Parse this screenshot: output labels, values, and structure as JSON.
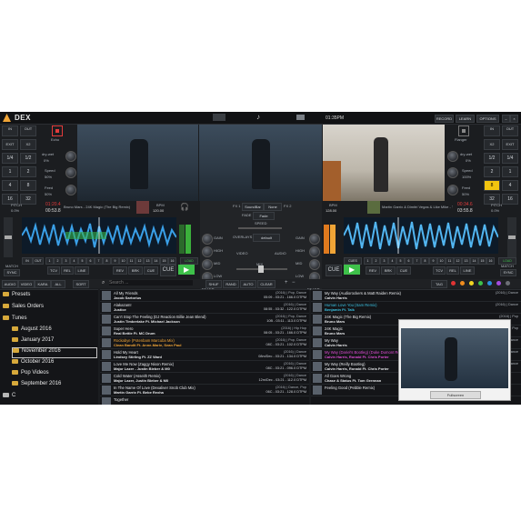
{
  "app": {
    "brand": "DEX",
    "clock": "01:35PM",
    "top_buttons": [
      "RECORD",
      "LEARN",
      "OPTIONS"
    ]
  },
  "left_deck": {
    "buttons": [
      "IN",
      "OUT",
      "EXIT",
      "X2",
      "1/4",
      "1/2",
      "1",
      "2",
      "4",
      "8",
      "16",
      "32"
    ],
    "fx_label": "Echo",
    "params": [
      {
        "name": "dry-wet",
        "value": "0%"
      },
      {
        "name": "Speed",
        "value": "50%"
      },
      {
        "name": "Feed",
        "value": "50%"
      }
    ],
    "pitch_label": "PITCH",
    "pitch_value": "0.0%",
    "time_top": "01:20.4",
    "time_bottom": "00:53.8",
    "title": "Bruno Mars - 24K Magic (The Big Remix)",
    "bpm_label": "BPM",
    "bpm_value": "120.00",
    "cue_buttons": [
      "IN",
      "OUT",
      "1",
      "2",
      "3",
      "4",
      "5",
      "6",
      "7",
      "8",
      "9",
      "10",
      "11",
      "12",
      "13",
      "14",
      "15",
      "16"
    ],
    "match": "MATCH",
    "sync": "SYNC",
    "modes": [
      "TCV",
      "REL",
      "LINE"
    ],
    "lower_buttons": [
      "REV",
      "BRK",
      "CUE"
    ],
    "cue": "CUE",
    "load": "LOAD"
  },
  "right_deck": {
    "buttons": [
      "IN",
      "OUT",
      "X2",
      "EXIT",
      "1/2",
      "1/4",
      "2",
      "1",
      "8",
      "4",
      "32",
      "16"
    ],
    "fx_label": "Flanger",
    "params": [
      {
        "name": "dry-wet",
        "value": "0%"
      },
      {
        "name": "Speed",
        "value": "100%"
      },
      {
        "name": "Feed",
        "value": "50%"
      }
    ],
    "pitch_label": "PITCH",
    "pitch_value": "0.0%",
    "time_top": "00:34.6",
    "time_bottom": "03:55.8",
    "title": "Martin Garrix & Dimitri Vegas & Like Mike - Tremor",
    "bpm_label": "BPM",
    "bpm_value": "128.00",
    "cue_buttons": [
      "CUES",
      "1",
      "2",
      "3",
      "4",
      "5",
      "6",
      "7",
      "8",
      "9",
      "10",
      "11",
      "12",
      "13",
      "14",
      "15",
      "16"
    ],
    "match": "MATCH",
    "sync": "SYNC",
    "modes": [
      "TCV",
      "REL",
      "LINE"
    ],
    "lower_buttons": [
      "REV",
      "BRK",
      "CUE"
    ],
    "cue": "CUE",
    "load": "LOAD"
  },
  "mixer": {
    "fx_left": "FX 1",
    "fx_right": "FX 2",
    "fx_select": "SoundBar",
    "fx_none": "None",
    "fade_label": "FADE",
    "fade_value": "Fade",
    "speed_label": "SPEED",
    "overlay_label": "OVERLAYS",
    "overlay_value": "default",
    "video_label": "VIDEO",
    "audio_label": "AUDIO",
    "mix_label": "MIX",
    "eq_left": [
      "GAIN",
      "HIGH",
      "MID",
      "LOW",
      "FILTER"
    ],
    "eq_right": [
      "GAIN",
      "HIGH",
      "MID",
      "LOW",
      "FILTER"
    ]
  },
  "browser_tabs": [
    "AUDIO",
    "VIDEO",
    "KARA",
    "ALL",
    "SORT"
  ],
  "search_placeholder": "Search ...",
  "list_actions": [
    "SHUF",
    "RAND",
    "AUTO",
    "CLEAR"
  ],
  "tag_label": "TAG",
  "tag_colors": [
    "#e03434",
    "#f08c1e",
    "#f2d422",
    "#3ec14a",
    "#2a8fe0",
    "#a44ce0",
    "#6c6f75"
  ],
  "tree": [
    "Presets",
    "Sales Orders",
    "Tunes",
    "August 2016",
    "January 2017",
    "November 2016",
    "October 2016",
    "Pop Videos",
    "September 2016",
    "C"
  ],
  "tracks": [
    {
      "title": "All My Friends",
      "artist": "Jacob Sartorius",
      "meta": "(2016) | Pop, Dance",
      "bpm": "05:09 - 03:21 - 166.0 DTPM",
      "color": "#e5e7ea"
    },
    {
      "title": "Alakazam!",
      "artist": "Justice",
      "meta": "(2016) | Dance",
      "bpm": "08:55 - 03:32 - 122.0 DTPM",
      "color": "#e5e7ea"
    },
    {
      "title": "Can't Stop The Feeling (DJ Reaction Billie Jean Blend)",
      "artist": "Justin Timberlake Ft. Michael Jackson",
      "meta": "(2016) | Pop, Dance",
      "bpm": "10B - 03:11 - 113.0 DTPM",
      "color": "#e5e7ea"
    },
    {
      "title": "Super Hero",
      "artist": "Real Bettle Ft. MC Drum",
      "meta": "(2016) | Hip Hop",
      "bpm": "08:05 - 03:21 - 166.0 DTPM",
      "color": "#e5e7ea"
    },
    {
      "title": "Rockabye (Potenbam Marcuba Mix)",
      "artist": "Clean Bandit Ft. Anne-Marie, Sean Paul",
      "meta": "(2016) | Pop, Dance",
      "bpm": "08C - 03:21 - 102.0 DTPM",
      "color": "#f0a436"
    },
    {
      "title": "Hold My Heart",
      "artist": "Lindsey Stirling Ft. ZZ Ward",
      "meta": "(2016) | Dance",
      "bpm": "08m/Dec - 03:21 - 134.0 DTPM",
      "color": "#e5e7ea"
    },
    {
      "title": "Love Me Now (Zaggy Nixon Remix)",
      "artist": "Major Lazer - Justin Bieber & M0",
      "meta": "(2016) | Dance",
      "bpm": "08C - 03:21 - 096.0 DTPM",
      "color": "#e5e7ea"
    },
    {
      "title": "Cold Water (Asseith Remix)",
      "artist": "Major Lazer, Justin Bieber & M0",
      "meta": "(2016) | Dance",
      "bpm": "12m/Dec - 03:21 - 112.0 DTPM",
      "color": "#e5e7ea"
    },
    {
      "title": "In The Name Of Love (Dexaliver Snob Club Mix)",
      "artist": "Martin Garrix Ft. Bebe Rexha",
      "meta": "(2016) | Dance, Pop",
      "bpm": "06C - 03:21 - 128.0 DTPM",
      "color": "#e5e7ea"
    },
    {
      "title": "Together",
      "artist": "",
      "meta": "",
      "bpm": "",
      "color": "#e5e7ea"
    }
  ],
  "right_tracks": [
    {
      "title": "My Way (Audiorockers & Matt Raiden Remix)",
      "artist": "Calvin Harris",
      "meta": "(2016) | Dance",
      "bpm": "",
      "color": "#e5e7ea"
    },
    {
      "title": "Human Love You (Sam Remix)",
      "artist": "Benjamin Ft. Talk",
      "meta": "(2016) | Dance",
      "bpm": "",
      "color": "#3bc0e0"
    },
    {
      "title": "24K Magic (The Big Remix)",
      "artist": "Bruno Mars",
      "meta": "(2016) | Pop",
      "bpm": "",
      "color": "#e5e7ea"
    },
    {
      "title": "24K Magic",
      "artist": "Bruno Mars",
      "meta": "(2016) | Pop",
      "bpm": "",
      "color": "#e5e7ea"
    },
    {
      "title": "My Way",
      "artist": "Calvin Harris",
      "meta": "(2016) | Dance",
      "bpm": "",
      "color": "#e5e7ea"
    },
    {
      "title": "My Way (Dariel's Bootleg) (Duke Dumont Remix)",
      "artist": "Calvin Harris, Ronald Ft. Chris Porter",
      "meta": "(2016) | Dance",
      "bpm": "",
      "color": "#e04cd6"
    },
    {
      "title": "My Way (Reilly Bootleg)",
      "artist": "Calvin Harris, Ronald Ft. Chris Porter",
      "meta": "(2016) | Dance",
      "bpm": "",
      "color": "#e5e7ea"
    },
    {
      "title": "All Goes Wrong",
      "artist": "Chase & Status Ft. Tom Grennan",
      "meta": "",
      "bpm": "",
      "color": "#e5e7ea"
    },
    {
      "title": "Feeling Good (Pebble Remix)",
      "artist": "",
      "meta": "",
      "bpm": "",
      "color": "#e5e7ea"
    }
  ],
  "popup": {
    "label": "Fullscreen"
  }
}
